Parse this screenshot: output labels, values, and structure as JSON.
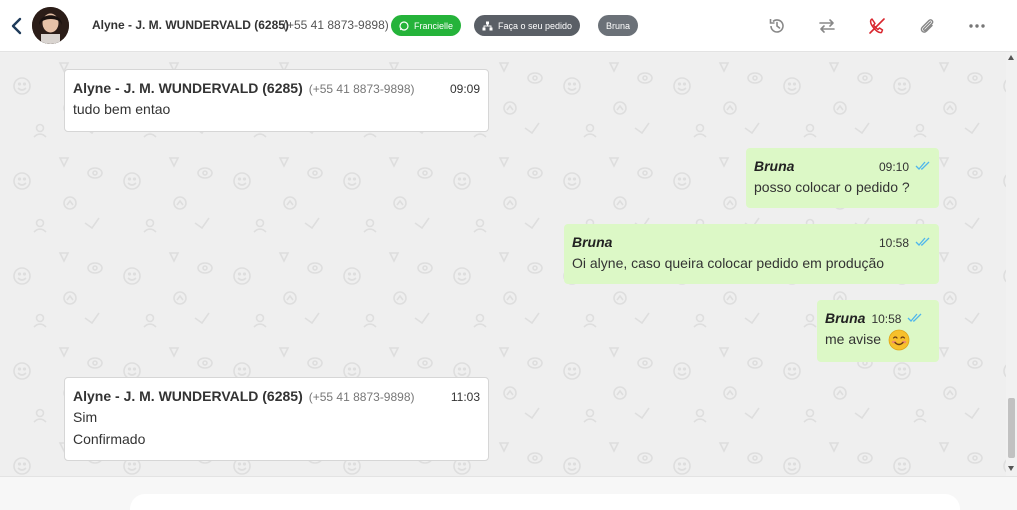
{
  "header": {
    "contact_name": "Alyne - J. M. WUNDERVALD (6285)",
    "contact_phone": "(+55 41 8873-9898)",
    "tags": [
      {
        "label": "Francielle",
        "color": "#25b33a"
      },
      {
        "label": "Faça o seu pedido",
        "color": "#5a5f66"
      },
      {
        "label": "Bruna",
        "color": "#6b7178"
      }
    ]
  },
  "messages": [
    {
      "direction": "in",
      "sender": "Alyne - J. M. WUNDERVALD (6285)",
      "phone": "(+55 41 8873-9898)",
      "time": "09:09",
      "lines": [
        "tudo bem entao"
      ]
    },
    {
      "direction": "out",
      "sender": "Bruna",
      "time": "09:10",
      "lines": [
        "posso colocar o pedido ?"
      ]
    },
    {
      "direction": "out",
      "sender": "Bruna",
      "time": "10:58",
      "lines": [
        "Oi alyne, caso queira colocar pedido em produção"
      ]
    },
    {
      "direction": "out",
      "sender": "Bruna",
      "time": "10:58",
      "lines": [
        "me avise"
      ]
    },
    {
      "direction": "in",
      "sender": "Alyne - J. M. WUNDERVALD (6285)",
      "phone": "(+55 41 8873-9898)",
      "time": "11:03",
      "lines": [
        "Sim",
        "Confirmado"
      ]
    }
  ],
  "icons": [
    "back-icon",
    "history-icon",
    "transfer-icon",
    "end-call-icon",
    "attachment-icon",
    "more-icon",
    "whatsapp-icon",
    "sitemap-icon",
    "double-check-icon",
    "smiling-face-emoji"
  ],
  "colors": {
    "outgoing_bubble": "#dcf8c6",
    "incoming_bubble": "#ffffff",
    "read_check": "#4fb6ec",
    "end_call": "#d9262e"
  }
}
